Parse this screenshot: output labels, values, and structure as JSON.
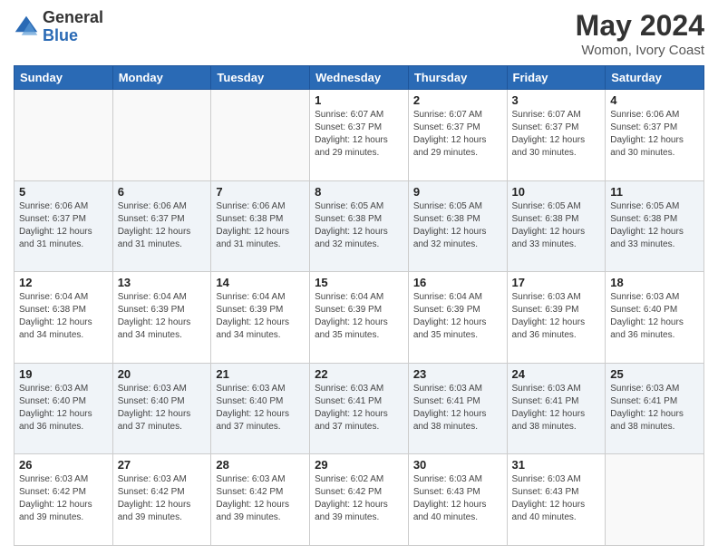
{
  "logo": {
    "general": "General",
    "blue": "Blue"
  },
  "title": "May 2024",
  "subtitle": "Womon, Ivory Coast",
  "headers": [
    "Sunday",
    "Monday",
    "Tuesday",
    "Wednesday",
    "Thursday",
    "Friday",
    "Saturday"
  ],
  "weeks": [
    [
      {
        "day": "",
        "sunrise": "",
        "sunset": "",
        "daylight": ""
      },
      {
        "day": "",
        "sunrise": "",
        "sunset": "",
        "daylight": ""
      },
      {
        "day": "",
        "sunrise": "",
        "sunset": "",
        "daylight": ""
      },
      {
        "day": "1",
        "sunrise": "Sunrise: 6:07 AM",
        "sunset": "Sunset: 6:37 PM",
        "daylight": "Daylight: 12 hours and 29 minutes."
      },
      {
        "day": "2",
        "sunrise": "Sunrise: 6:07 AM",
        "sunset": "Sunset: 6:37 PM",
        "daylight": "Daylight: 12 hours and 29 minutes."
      },
      {
        "day": "3",
        "sunrise": "Sunrise: 6:07 AM",
        "sunset": "Sunset: 6:37 PM",
        "daylight": "Daylight: 12 hours and 30 minutes."
      },
      {
        "day": "4",
        "sunrise": "Sunrise: 6:06 AM",
        "sunset": "Sunset: 6:37 PM",
        "daylight": "Daylight: 12 hours and 30 minutes."
      }
    ],
    [
      {
        "day": "5",
        "sunrise": "Sunrise: 6:06 AM",
        "sunset": "Sunset: 6:37 PM",
        "daylight": "Daylight: 12 hours and 31 minutes."
      },
      {
        "day": "6",
        "sunrise": "Sunrise: 6:06 AM",
        "sunset": "Sunset: 6:37 PM",
        "daylight": "Daylight: 12 hours and 31 minutes."
      },
      {
        "day": "7",
        "sunrise": "Sunrise: 6:06 AM",
        "sunset": "Sunset: 6:38 PM",
        "daylight": "Daylight: 12 hours and 31 minutes."
      },
      {
        "day": "8",
        "sunrise": "Sunrise: 6:05 AM",
        "sunset": "Sunset: 6:38 PM",
        "daylight": "Daylight: 12 hours and 32 minutes."
      },
      {
        "day": "9",
        "sunrise": "Sunrise: 6:05 AM",
        "sunset": "Sunset: 6:38 PM",
        "daylight": "Daylight: 12 hours and 32 minutes."
      },
      {
        "day": "10",
        "sunrise": "Sunrise: 6:05 AM",
        "sunset": "Sunset: 6:38 PM",
        "daylight": "Daylight: 12 hours and 33 minutes."
      },
      {
        "day": "11",
        "sunrise": "Sunrise: 6:05 AM",
        "sunset": "Sunset: 6:38 PM",
        "daylight": "Daylight: 12 hours and 33 minutes."
      }
    ],
    [
      {
        "day": "12",
        "sunrise": "Sunrise: 6:04 AM",
        "sunset": "Sunset: 6:38 PM",
        "daylight": "Daylight: 12 hours and 34 minutes."
      },
      {
        "day": "13",
        "sunrise": "Sunrise: 6:04 AM",
        "sunset": "Sunset: 6:39 PM",
        "daylight": "Daylight: 12 hours and 34 minutes."
      },
      {
        "day": "14",
        "sunrise": "Sunrise: 6:04 AM",
        "sunset": "Sunset: 6:39 PM",
        "daylight": "Daylight: 12 hours and 34 minutes."
      },
      {
        "day": "15",
        "sunrise": "Sunrise: 6:04 AM",
        "sunset": "Sunset: 6:39 PM",
        "daylight": "Daylight: 12 hours and 35 minutes."
      },
      {
        "day": "16",
        "sunrise": "Sunrise: 6:04 AM",
        "sunset": "Sunset: 6:39 PM",
        "daylight": "Daylight: 12 hours and 35 minutes."
      },
      {
        "day": "17",
        "sunrise": "Sunrise: 6:03 AM",
        "sunset": "Sunset: 6:39 PM",
        "daylight": "Daylight: 12 hours and 36 minutes."
      },
      {
        "day": "18",
        "sunrise": "Sunrise: 6:03 AM",
        "sunset": "Sunset: 6:40 PM",
        "daylight": "Daylight: 12 hours and 36 minutes."
      }
    ],
    [
      {
        "day": "19",
        "sunrise": "Sunrise: 6:03 AM",
        "sunset": "Sunset: 6:40 PM",
        "daylight": "Daylight: 12 hours and 36 minutes."
      },
      {
        "day": "20",
        "sunrise": "Sunrise: 6:03 AM",
        "sunset": "Sunset: 6:40 PM",
        "daylight": "Daylight: 12 hours and 37 minutes."
      },
      {
        "day": "21",
        "sunrise": "Sunrise: 6:03 AM",
        "sunset": "Sunset: 6:40 PM",
        "daylight": "Daylight: 12 hours and 37 minutes."
      },
      {
        "day": "22",
        "sunrise": "Sunrise: 6:03 AM",
        "sunset": "Sunset: 6:41 PM",
        "daylight": "Daylight: 12 hours and 37 minutes."
      },
      {
        "day": "23",
        "sunrise": "Sunrise: 6:03 AM",
        "sunset": "Sunset: 6:41 PM",
        "daylight": "Daylight: 12 hours and 38 minutes."
      },
      {
        "day": "24",
        "sunrise": "Sunrise: 6:03 AM",
        "sunset": "Sunset: 6:41 PM",
        "daylight": "Daylight: 12 hours and 38 minutes."
      },
      {
        "day": "25",
        "sunrise": "Sunrise: 6:03 AM",
        "sunset": "Sunset: 6:41 PM",
        "daylight": "Daylight: 12 hours and 38 minutes."
      }
    ],
    [
      {
        "day": "26",
        "sunrise": "Sunrise: 6:03 AM",
        "sunset": "Sunset: 6:42 PM",
        "daylight": "Daylight: 12 hours and 39 minutes."
      },
      {
        "day": "27",
        "sunrise": "Sunrise: 6:03 AM",
        "sunset": "Sunset: 6:42 PM",
        "daylight": "Daylight: 12 hours and 39 minutes."
      },
      {
        "day": "28",
        "sunrise": "Sunrise: 6:03 AM",
        "sunset": "Sunset: 6:42 PM",
        "daylight": "Daylight: 12 hours and 39 minutes."
      },
      {
        "day": "29",
        "sunrise": "Sunrise: 6:02 AM",
        "sunset": "Sunset: 6:42 PM",
        "daylight": "Daylight: 12 hours and 39 minutes."
      },
      {
        "day": "30",
        "sunrise": "Sunrise: 6:03 AM",
        "sunset": "Sunset: 6:43 PM",
        "daylight": "Daylight: 12 hours and 40 minutes."
      },
      {
        "day": "31",
        "sunrise": "Sunrise: 6:03 AM",
        "sunset": "Sunset: 6:43 PM",
        "daylight": "Daylight: 12 hours and 40 minutes."
      },
      {
        "day": "",
        "sunrise": "",
        "sunset": "",
        "daylight": ""
      }
    ]
  ]
}
